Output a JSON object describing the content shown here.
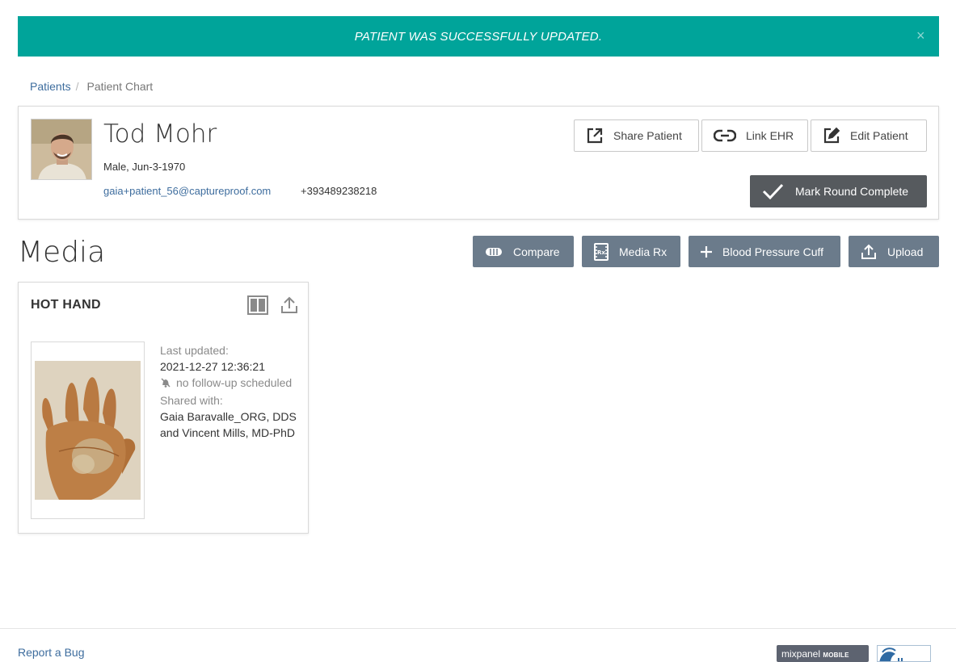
{
  "alert": {
    "message": "PATIENT WAS SUCCESSFULLY UPDATED.",
    "close_glyph": "×",
    "color": "#00a49a"
  },
  "breadcrumb": {
    "root": "Patients",
    "separator": "/",
    "current": "Patient Chart"
  },
  "patient": {
    "name": "Tod Mohr",
    "sex_dob": "Male, Jun-3-1970",
    "email": "gaia+patient_56@captureproof.com",
    "phone": "+393489238218",
    "actions": {
      "share": "Share Patient",
      "link": "Link EHR",
      "edit": "Edit Patient",
      "mark_round": "Mark Round Complete"
    }
  },
  "media": {
    "title": "Media",
    "toolbar": {
      "compare": "Compare",
      "media_rx": "Media Rx",
      "blood_pressure": "Blood Pressure Cuff",
      "upload": "Upload"
    },
    "cards": [
      {
        "title": "HOT HAND",
        "last_updated_label": "Last updated:",
        "last_updated": "2021-12-27 12:36:21",
        "follow_up": "no follow-up scheduled",
        "shared_with_label": "Shared with:",
        "shared_with": "Gaia Baravalle_ORG, DDS and Vincent Mills, MD-PhD"
      }
    ]
  },
  "footer": {
    "report_bug": "Report a Bug",
    "mixpanel_text": "mixpanel",
    "mixpanel_sub": "MOBILE"
  },
  "colors": {
    "accent": "#00a49a",
    "slate_button": "#6b7b8b",
    "dark_button": "#565a5e",
    "link": "#3e6d9e"
  }
}
